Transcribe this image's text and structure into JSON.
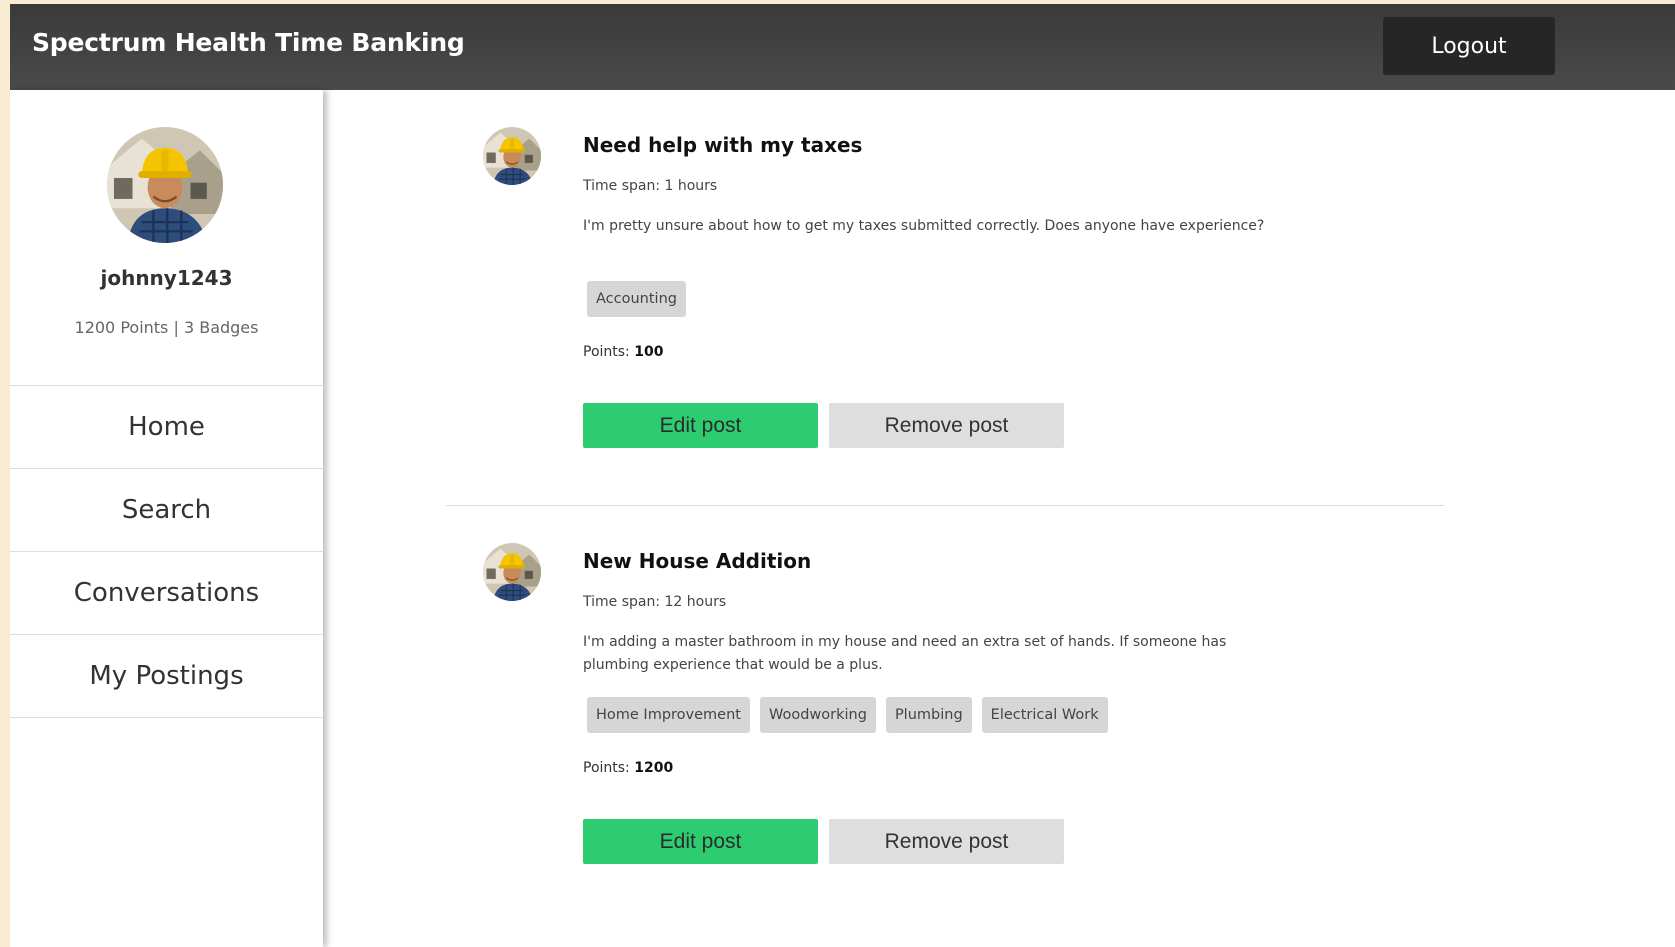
{
  "header": {
    "app_title": "Spectrum Health Time Banking",
    "logout_label": "Logout"
  },
  "profile": {
    "username": "johnny1243",
    "stats": "1200 Points | 3 Badges"
  },
  "nav": {
    "items": [
      {
        "label": "Home"
      },
      {
        "label": "Search"
      },
      {
        "label": "Conversations"
      },
      {
        "label": "My Postings"
      }
    ]
  },
  "posts": [
    {
      "title": "Need help with my taxes",
      "time_span": "Time span: 1 hours",
      "description": "I'm pretty unsure about how to get my taxes submitted correctly. Does anyone have experience?",
      "tags": [
        "Accounting"
      ],
      "points_label": "Points:",
      "points_value": "100",
      "edit_label": "Edit post",
      "remove_label": "Remove post"
    },
    {
      "title": "New House Addition",
      "time_span": "Time span: 12 hours",
      "description": "I'm adding a master bathroom in my house and need an extra set of hands. If someone has plumbing experience that would be a plus.",
      "tags": [
        "Home Improvement",
        "Woodworking",
        "Plumbing",
        "Electrical Work"
      ],
      "points_label": "Points:",
      "points_value": "1200",
      "edit_label": "Edit post",
      "remove_label": "Remove post"
    }
  ],
  "colors": {
    "header_bg": "#444444",
    "logout_bg": "#262626",
    "edit_button": "#2ecc71",
    "remove_button": "#dedede",
    "tag_bg": "#d6d6d6",
    "page_bg": "#f9ecd3"
  }
}
